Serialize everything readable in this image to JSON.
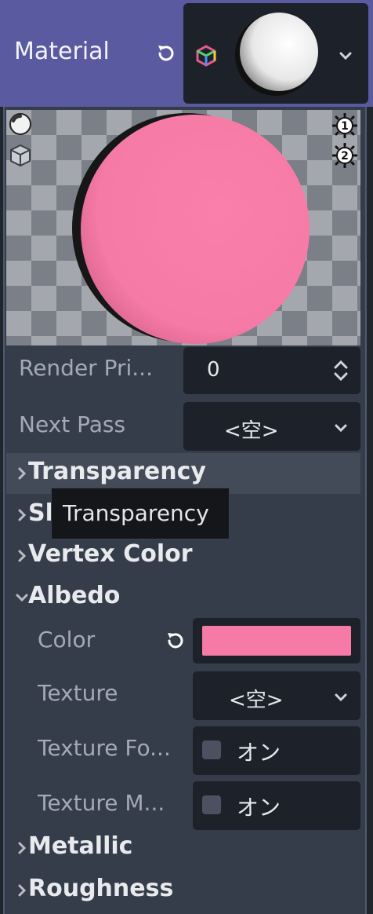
{
  "header": {
    "title": "Material",
    "reset_icon": "reset-icon",
    "resource_icon": "standard-material-icon",
    "dropdown_icon": "chevron-down-icon"
  },
  "preview": {
    "light_icon": "light-toggle-icon",
    "shape_icon": "cube-shape-icon",
    "light1_icon": "light-1-icon",
    "light1_text": "1",
    "light2_icon": "light-2-icon",
    "light2_text": "2",
    "sphere_color": "#f97ba6"
  },
  "properties": {
    "render_priority": {
      "label": "Render Pri...",
      "value": "0"
    },
    "next_pass": {
      "label": "Next Pass",
      "value": "<空>"
    }
  },
  "sections": {
    "transparency": "Transparency",
    "shading": "Sh",
    "vertex_color": "Vertex Color",
    "albedo": "Albedo",
    "metallic": "Metallic",
    "roughness": "Roughness"
  },
  "tooltip": {
    "text": "Transparency"
  },
  "albedo": {
    "color_label": "Color",
    "color_value": "#f57aa5",
    "texture_label": "Texture",
    "texture_value": "<空>",
    "texture_force_srgb_label": "Texture Fo...",
    "texture_force_srgb_value": "オン",
    "texture_msdf_label": "Texture M...",
    "texture_msdf_value": "オン"
  },
  "colors": {
    "header_bg": "#5a5aa0",
    "panel_bg": "#363d4a",
    "field_bg": "#1d2129",
    "accent_pink": "#f57aa5"
  }
}
